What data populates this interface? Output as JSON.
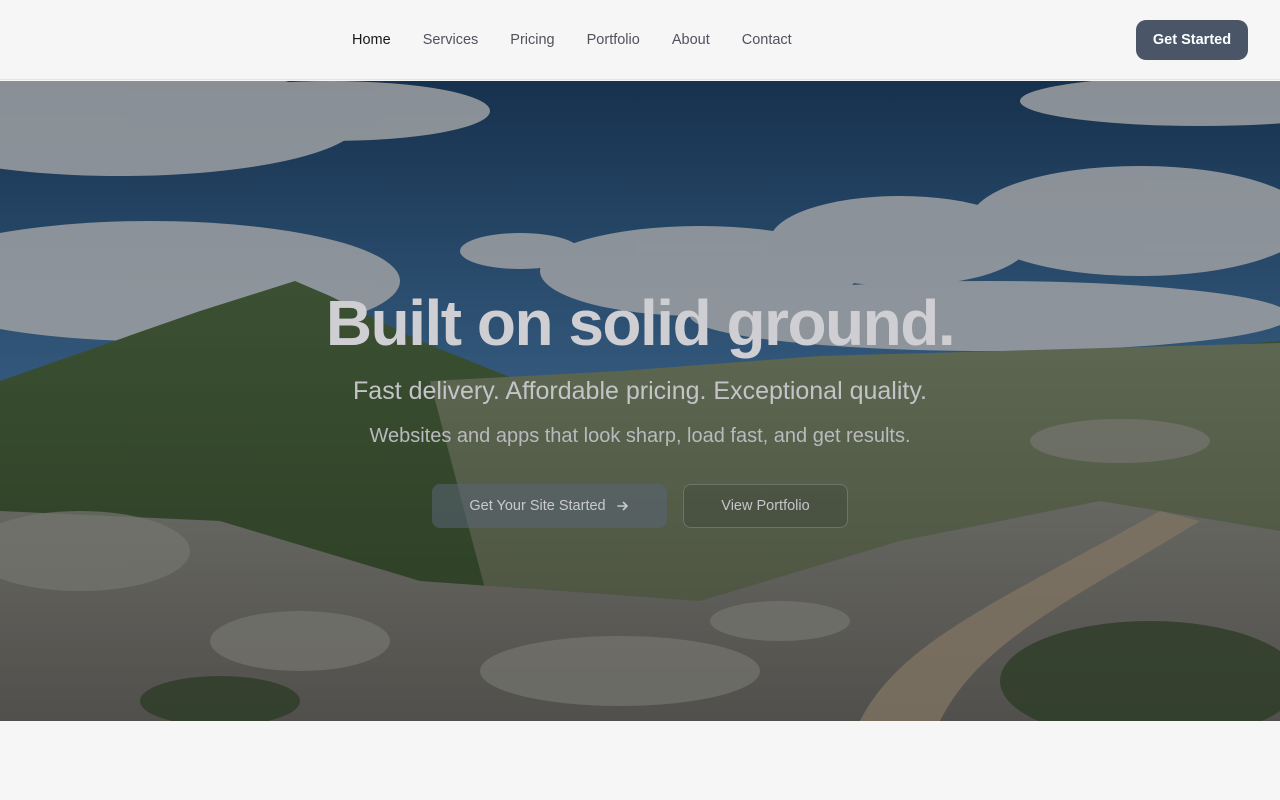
{
  "nav": {
    "links": [
      {
        "label": "Home",
        "active": true
      },
      {
        "label": "Services",
        "active": false
      },
      {
        "label": "Pricing",
        "active": false
      },
      {
        "label": "Portfolio",
        "active": false
      },
      {
        "label": "About",
        "active": false
      },
      {
        "label": "Contact",
        "active": false
      }
    ],
    "cta_label": "Get Started"
  },
  "hero": {
    "title": "Built on solid ground.",
    "tagline": "Fast delivery. Affordable pricing. Exceptional quality.",
    "subtitle": "Websites and apps that look sharp, load fast, and get results.",
    "primary_label": "Get Your Site Started",
    "primary_icon": "arrow-right-icon",
    "secondary_label": "View Portfolio"
  },
  "colors": {
    "accent": "#4a5568",
    "background": "#f6f6f7"
  }
}
